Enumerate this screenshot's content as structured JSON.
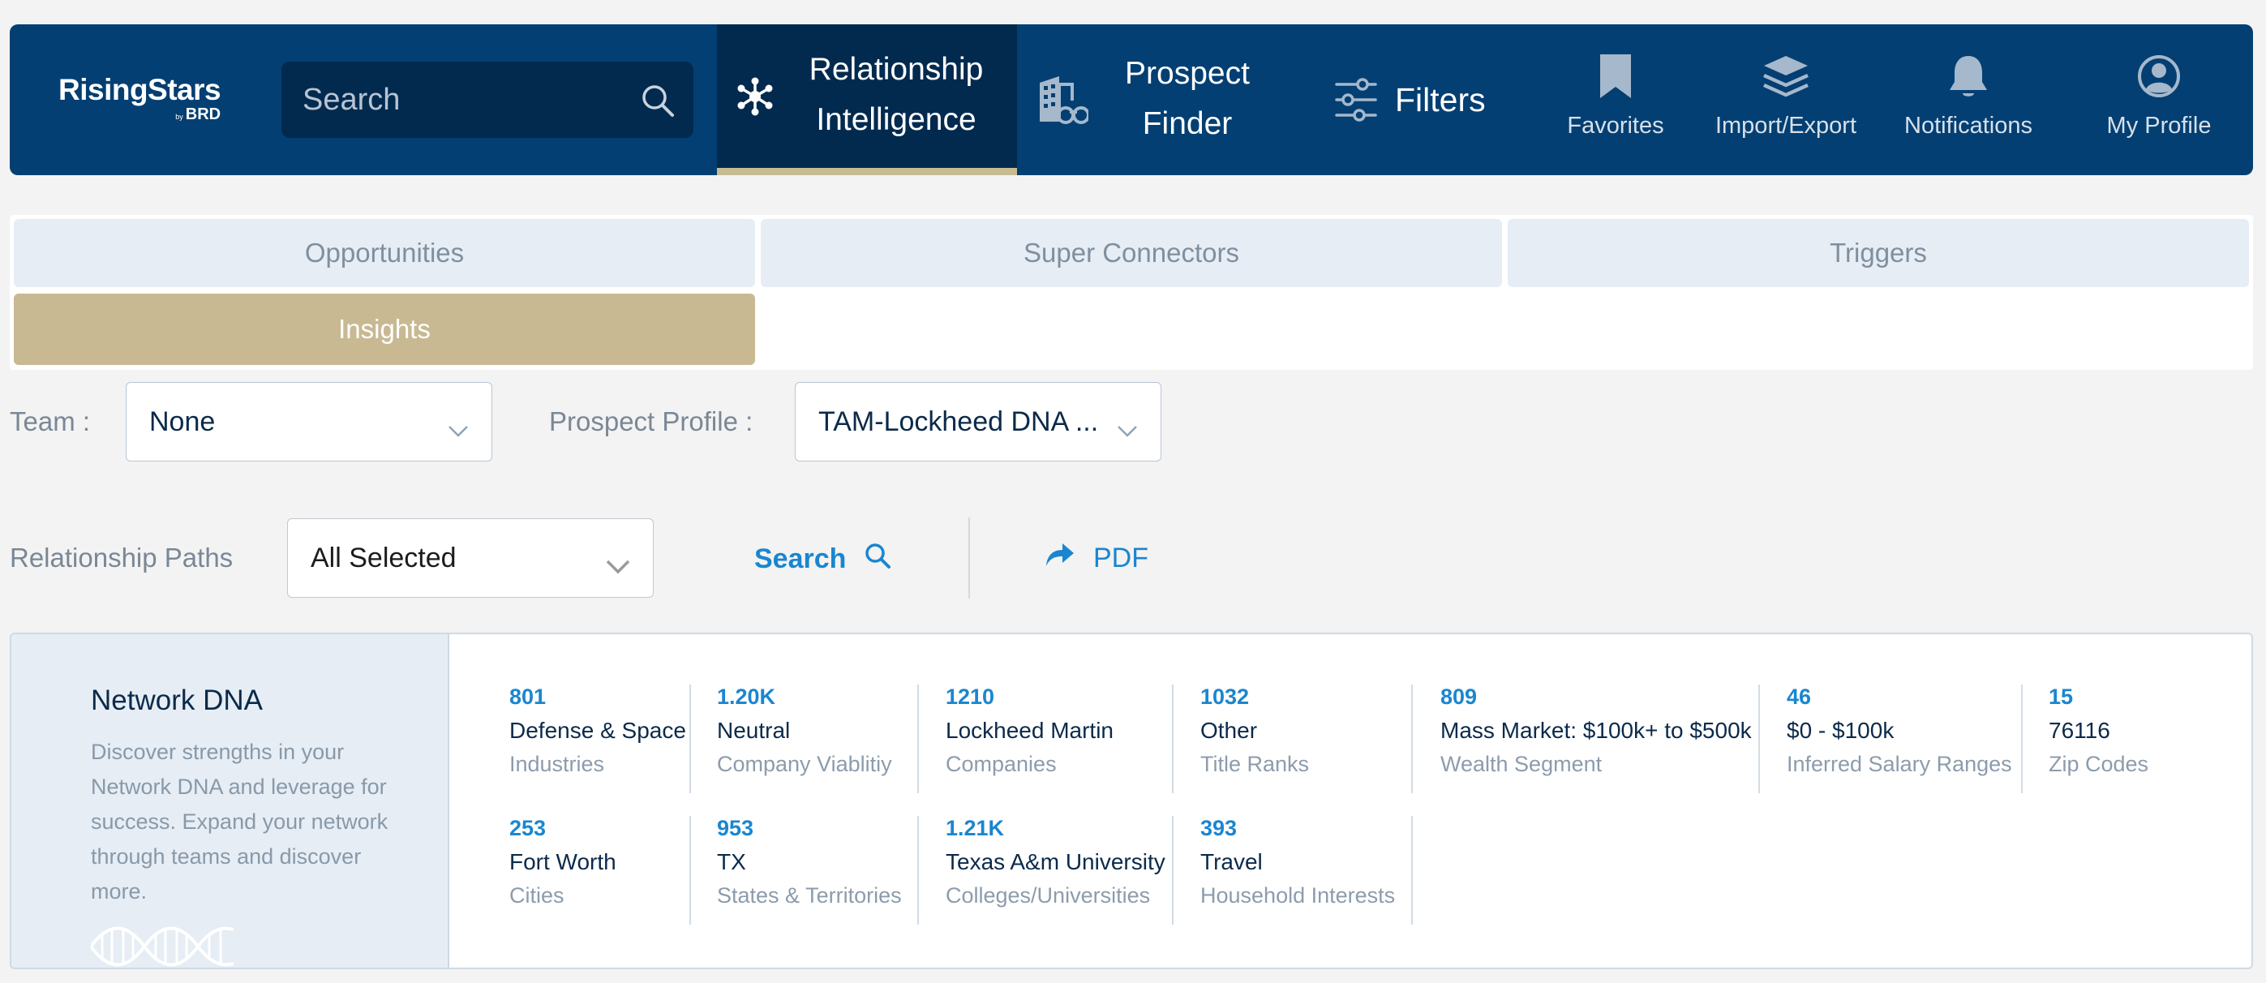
{
  "brand": {
    "name": "RisingStars",
    "by": "by",
    "sub": "BRD"
  },
  "search": {
    "placeholder": "Search"
  },
  "nav": {
    "relationship": {
      "line1": "Relationship",
      "line2": "Intelligence"
    },
    "prospect": {
      "line1": "Prospect",
      "line2": "Finder"
    },
    "filters": "Filters",
    "favorites": "Favorites",
    "import_export": "Import/Export",
    "notifications": "Notifications",
    "my_profile": "My Profile"
  },
  "tabs": [
    "Opportunities",
    "Super Connectors",
    "Triggers",
    "Insights"
  ],
  "filters": {
    "team_label": "Team :",
    "team_value": "None",
    "profile_label": "Prospect Profile :",
    "profile_value": "TAM-Lockheed DNA ...",
    "paths_label": "Relationship Paths",
    "paths_value": "All Selected",
    "search_label": "Search",
    "pdf_label": "PDF"
  },
  "dna": {
    "title": "Network DNA",
    "description": "Discover strengths in your Network DNA and leverage for success. Expand your network through teams and discover more.",
    "stats": [
      {
        "value": "801",
        "name": "Defense & Space",
        "category": "Industries"
      },
      {
        "value": "1.20K",
        "name": "Neutral",
        "category": "Company Viablitiy"
      },
      {
        "value": "1210",
        "name": "Lockheed Martin",
        "category": "Companies"
      },
      {
        "value": "1032",
        "name": "Other",
        "category": "Title Ranks"
      },
      {
        "value": "809",
        "name": "Mass Market: $100k+ to $500k",
        "category": "Wealth Segment"
      },
      {
        "value": "46",
        "name": "$0 - $100k",
        "category": "Inferred Salary Ranges"
      },
      {
        "value": "15",
        "name": "76116",
        "category": "Zip Codes"
      },
      {
        "value": "253",
        "name": "Fort Worth",
        "category": "Cities"
      },
      {
        "value": "953",
        "name": "TX",
        "category": "States & Territories"
      },
      {
        "value": "1.21K",
        "name": "Texas A&m University",
        "category": "Colleges/Universities"
      },
      {
        "value": "393",
        "name": "Travel",
        "category": "Household Interests"
      }
    ]
  },
  "colors": {
    "nav_bg": "#033f72",
    "nav_active": "#022a4f",
    "accent_gold": "#c8b993",
    "link_blue": "#1a86d0"
  }
}
